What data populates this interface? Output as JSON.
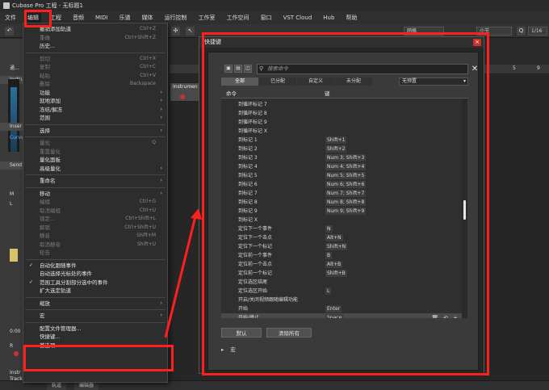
{
  "window": {
    "title": "Cubase Pro 工程 - 无标题1"
  },
  "menubar": [
    "文件",
    "编辑",
    "工程",
    "音频",
    "MIDI",
    "乐谱",
    "媒体",
    "运行控制",
    "工作室",
    "工作空间",
    "窗口",
    "VST Cloud",
    "Hub",
    "帮助"
  ],
  "toolbar": {
    "quantize": "1/16",
    "field1": "网格",
    "field2": "小节"
  },
  "inspector": {
    "tab": "通...",
    "track": "Instru",
    "insert": "Inser",
    "send": "Send",
    "curve": "Curve",
    "mute": "M",
    "record": "R",
    "solo": "L",
    "time": "0:00",
    "track_name": "Instr Track 01"
  },
  "arrange": {
    "track_label": "Instrumen",
    "ruler_marks": [
      "1",
      "5",
      "9"
    ]
  },
  "bottom_tabs": [
    "轨道",
    "编辑器"
  ],
  "edit_menu": {
    "items": [
      {
        "label": "撤销添加轨道",
        "shortcut": "Ctrl+Z",
        "disabled": false
      },
      {
        "label": "重做",
        "shortcut": "Ctrl+Shift+Z",
        "disabled": true
      },
      {
        "label": "历史...",
        "shortcut": "",
        "disabled": false
      },
      {
        "sep": true
      },
      {
        "label": "剪切",
        "shortcut": "Ctrl+X",
        "disabled": true
      },
      {
        "label": "复制",
        "shortcut": "Ctrl+C",
        "disabled": true
      },
      {
        "label": "粘贴",
        "shortcut": "Ctrl+V",
        "disabled": true
      },
      {
        "label": "删除",
        "shortcut": "Backspace",
        "disabled": true
      },
      {
        "label": "功能",
        "shortcut": "",
        "disabled": false,
        "submenu": true
      },
      {
        "label": "就地添加",
        "shortcut": "",
        "disabled": false,
        "submenu": true
      },
      {
        "label": "冻结/解冻",
        "shortcut": "",
        "disabled": false,
        "submenu": true
      },
      {
        "label": "范围",
        "shortcut": "",
        "disabled": false,
        "submenu": true
      },
      {
        "sep": true
      },
      {
        "label": "选择",
        "shortcut": "",
        "disabled": false,
        "submenu": true
      },
      {
        "sep": true
      },
      {
        "label": "量化",
        "shortcut": "Q",
        "disabled": true
      },
      {
        "label": "重置量化",
        "shortcut": "",
        "disabled": true
      },
      {
        "label": "量化面板",
        "shortcut": "",
        "disabled": false
      },
      {
        "label": "高级量化",
        "shortcut": "",
        "disabled": false,
        "submenu": true
      },
      {
        "sep": true
      },
      {
        "label": "重命名",
        "shortcut": "",
        "disabled": false,
        "submenu": true
      },
      {
        "sep": true
      },
      {
        "label": "移动",
        "shortcut": "",
        "disabled": false,
        "submenu": true
      },
      {
        "label": "编组",
        "shortcut": "Ctrl+G",
        "disabled": true
      },
      {
        "label": "取消编组",
        "shortcut": "Ctrl+U",
        "disabled": true
      },
      {
        "label": "锁定...",
        "shortcut": "Ctrl+Shift+L",
        "disabled": true
      },
      {
        "label": "解锁",
        "shortcut": "Ctrl+Shift+U",
        "disabled": true
      },
      {
        "label": "静音",
        "shortcut": "Shift+M",
        "disabled": true
      },
      {
        "label": "取消静音",
        "shortcut": "Shift+U",
        "disabled": true
      },
      {
        "label": "轮告",
        "shortcut": "",
        "disabled": true
      },
      {
        "sep": true
      },
      {
        "label": "自动化跟随事件",
        "shortcut": "",
        "disabled": false,
        "checked": true
      },
      {
        "label": "自动选择光标处的事件",
        "shortcut": "",
        "disabled": false
      },
      {
        "label": "范围工具分割部分选中的事件",
        "shortcut": "",
        "disabled": false,
        "checked": true
      },
      {
        "label": "扩大选定轨道",
        "shortcut": "",
        "disabled": false
      },
      {
        "sep": true
      },
      {
        "label": "缩放",
        "shortcut": "",
        "disabled": false,
        "submenu": true
      },
      {
        "sep": true
      },
      {
        "label": "宏",
        "shortcut": "",
        "disabled": false,
        "submenu": true
      },
      {
        "sep": true
      },
      {
        "label": "配置文件管理器...",
        "shortcut": "",
        "disabled": false
      },
      {
        "label": "快捷键...",
        "shortcut": "",
        "disabled": false
      },
      {
        "label": "首选项...",
        "shortcut": "",
        "disabled": false
      }
    ]
  },
  "dialog": {
    "title": "快捷键",
    "close": "×",
    "search_placeholder": "搜索命令",
    "filter_tabs": [
      "全部",
      "已分配",
      "自定义",
      "未分配"
    ],
    "preset": "无预置",
    "col_command": "命令",
    "col_key": "键",
    "rows": [
      {
        "name": "到循环标记 7",
        "key": ""
      },
      {
        "name": "到循环标记 8",
        "key": ""
      },
      {
        "name": "到循环标记 9",
        "key": ""
      },
      {
        "name": "到循环标记 X",
        "key": ""
      },
      {
        "name": "到标记 1",
        "key": "Shift+1"
      },
      {
        "name": "到标记 2",
        "key": "Shift+2"
      },
      {
        "name": "到标记 3",
        "key": "Num 3; Shift+3"
      },
      {
        "name": "到标记 4",
        "key": "Num 4; Shift+4"
      },
      {
        "name": "到标记 5",
        "key": "Num 5; Shift+5"
      },
      {
        "name": "到标记 6",
        "key": "Num 6; Shift+6"
      },
      {
        "name": "到标记 7",
        "key": "Num 7; Shift+7"
      },
      {
        "name": "到标记 8",
        "key": "Num 8; Shift+8"
      },
      {
        "name": "到标记 9",
        "key": "Num 9; Shift+9"
      },
      {
        "name": "到标记 X",
        "key": ""
      },
      {
        "name": "定位下一个事件",
        "key": "N"
      },
      {
        "name": "定位下一个击点",
        "key": "Alt+N"
      },
      {
        "name": "定位下一个标记",
        "key": "Shift+N"
      },
      {
        "name": "定位前一个事件",
        "key": "B"
      },
      {
        "name": "定位前一个击点",
        "key": "Alt+B"
      },
      {
        "name": "定位前一个标记",
        "key": "Shift+B"
      },
      {
        "name": "定位选区结尾",
        "key": ""
      },
      {
        "name": "定位选区开始",
        "key": "L"
      },
      {
        "name": "开启/关闭视频跟随编辑功能",
        "key": ""
      },
      {
        "name": "开始",
        "key": "Enter"
      },
      {
        "name": "开始/停止",
        "key": "Space"
      }
    ],
    "selected_index": 24,
    "btn_default": "默认",
    "btn_clear": "清除所有",
    "macro": "宏",
    "icon_delete": "🗑",
    "icon_reset": "↶",
    "icon_add": "+"
  }
}
